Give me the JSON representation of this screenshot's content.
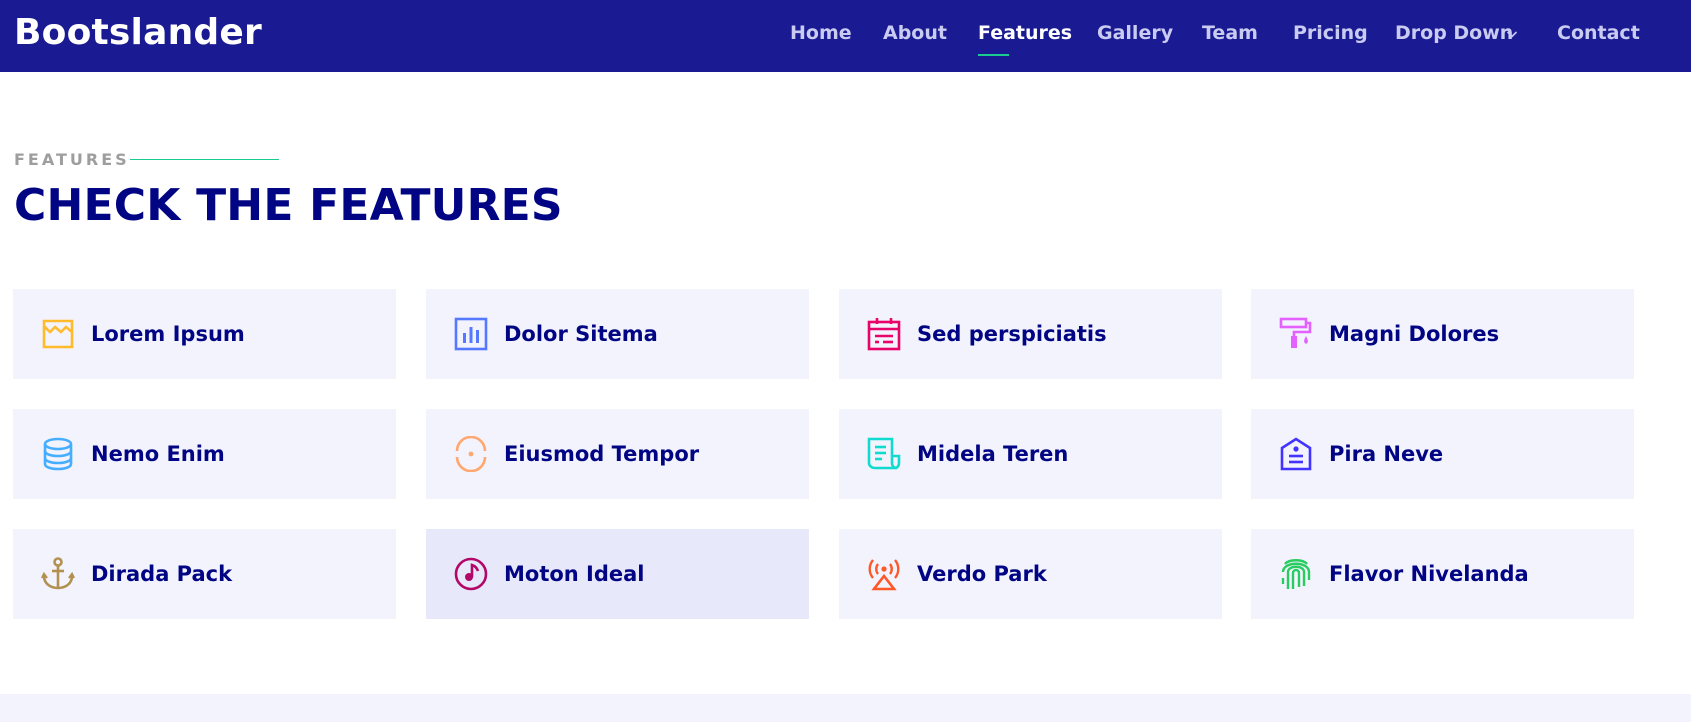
{
  "brand": {
    "name": "Bootslander"
  },
  "nav": {
    "items": [
      {
        "label": "Home"
      },
      {
        "label": "About"
      },
      {
        "label": "Features"
      },
      {
        "label": "Gallery"
      },
      {
        "label": "Team"
      },
      {
        "label": "Pricing"
      },
      {
        "label": "Drop Down"
      },
      {
        "label": "Contact"
      }
    ],
    "active": "Features"
  },
  "section": {
    "eyebrow": "FEATURES",
    "title": "CHECK THE FEATURES"
  },
  "features": [
    {
      "label": "Lorem Ipsum",
      "icon": "store-icon",
      "color": "#ffbb2c"
    },
    {
      "label": "Dolor Sitema",
      "icon": "bar-chart-icon",
      "color": "#5578ff"
    },
    {
      "label": "Sed perspiciatis",
      "icon": "calendar-icon",
      "color": "#e80368"
    },
    {
      "label": "Magni Dolores",
      "icon": "paint-roller-icon",
      "color": "#e361ff"
    },
    {
      "label": "Nemo Enim",
      "icon": "database-icon",
      "color": "#47aeff"
    },
    {
      "label": "Eiusmod Tempor",
      "icon": "gradienter-icon",
      "color": "#ffa76e"
    },
    {
      "label": "Midela Teren",
      "icon": "file-list-icon",
      "color": "#11dbcf"
    },
    {
      "label": "Pira Neve",
      "icon": "price-tag-icon",
      "color": "#4233ff"
    },
    {
      "label": "Dirada Pack",
      "icon": "anchor-icon",
      "color": "#b2904f"
    },
    {
      "label": "Moton Ideal",
      "icon": "disc-icon",
      "color": "#b20969"
    },
    {
      "label": "Verdo Park",
      "icon": "base-station-icon",
      "color": "#ff5828"
    },
    {
      "label": "Flavor Nivelanda",
      "icon": "fingerprint-icon",
      "color": "#29cc61"
    }
  ],
  "colors": {
    "header_bg": "#1a1a93",
    "accent": "#1acc8d",
    "heading": "#010483",
    "card_bg": "#f3f3fd"
  }
}
